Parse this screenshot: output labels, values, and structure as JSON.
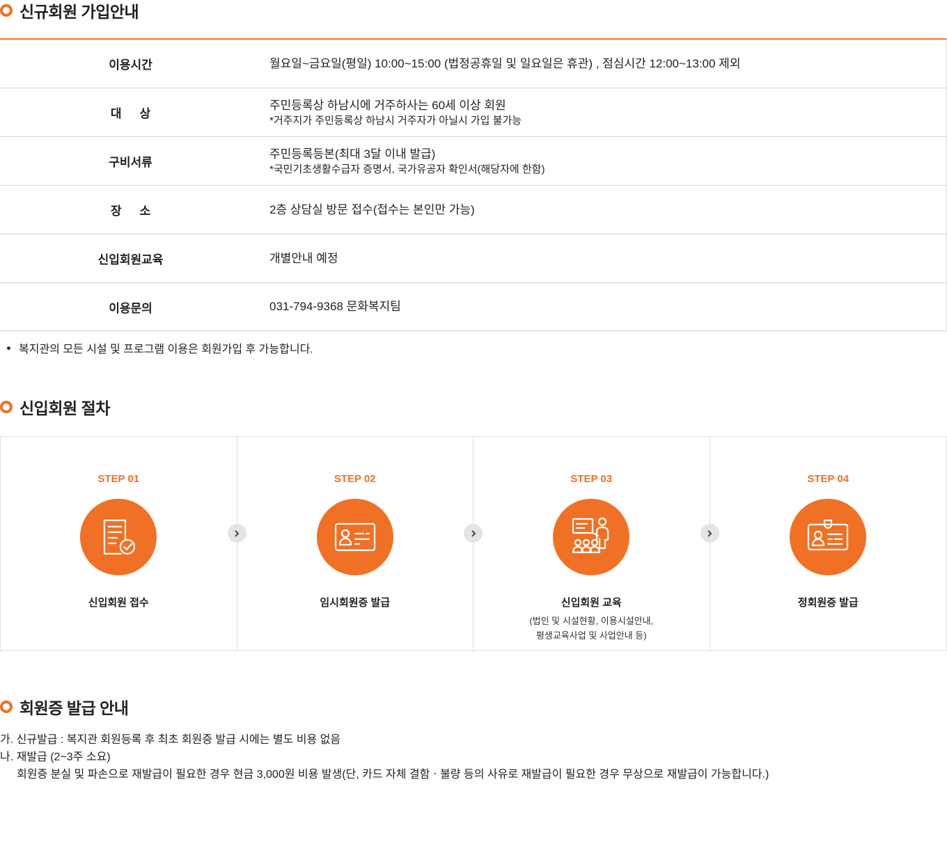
{
  "section1": {
    "title": "신규회원 가입안내",
    "rows": [
      {
        "label": "이용시간",
        "value": "월요일~금요일(평일) 10:00~15:00 (법정공휴일 및 일요일은 휴관) , 점심시간 12:00~13:00 제외",
        "sub": ""
      },
      {
        "label": "대상",
        "value": "주민등록상 하남시에 거주하사는 60세 이상 회원",
        "sub": "*거주지가 주민등록상 하남시 거주자가 아닐시 가입 불가능"
      },
      {
        "label": "구비서류",
        "value": "주민등록등본(최대 3달 이내 발급)",
        "sub": "*국민기초생활수급자 증명서, 국가유공자 확인서(해당자에 한함)"
      },
      {
        "label": "장소",
        "value": "2층 상담실 방문 접수(접수는 본인만 가능)",
        "sub": ""
      },
      {
        "label": "신입회원교육",
        "value": "개별안내 예정",
        "sub": ""
      },
      {
        "label": "이용문의",
        "value": "031-794-9368 문화복지팀",
        "sub": ""
      }
    ],
    "note": "복지관의 모든 시설 및 프로그램 이용은 회원가입 후 가능합니다."
  },
  "section2": {
    "title": "신입회원 절차",
    "steps": [
      {
        "label": "STEP 01",
        "icon": "document-check-icon",
        "name": "신입회원 접수",
        "desc1": "",
        "desc2": ""
      },
      {
        "label": "STEP 02",
        "icon": "id-card-icon",
        "name": "임시회원증 발급",
        "desc1": "",
        "desc2": ""
      },
      {
        "label": "STEP 03",
        "icon": "presentation-icon",
        "name": "신입회원 교육",
        "desc1": "(법인 및 시설현황, 이용시설안내,",
        "desc2": "평생교육사업 및 사업안내 등)"
      },
      {
        "label": "STEP 04",
        "icon": "badge-card-icon",
        "name": "정회원증 발급",
        "desc1": "",
        "desc2": ""
      }
    ]
  },
  "section3": {
    "title": "회원증 발급 안내",
    "line1": "가. 신규발급 : 복지관 회원등록 후 최초 회원증 발급 시에는 별도 비용 없음",
    "line2": "나. 재발급 (2~3주 소요)",
    "line3": "회원증 분실 및 파손으로 재발급이 필요한 경우 현금 3,000원 비용 발생(단, 카드 자체 결함ㆍ불량 등의 사유로 재발급이 필요한 경우 무상으로 재발급이 가능합니다.)"
  },
  "colors": {
    "accent": "#f07125",
    "border": "#d6d6d6"
  }
}
